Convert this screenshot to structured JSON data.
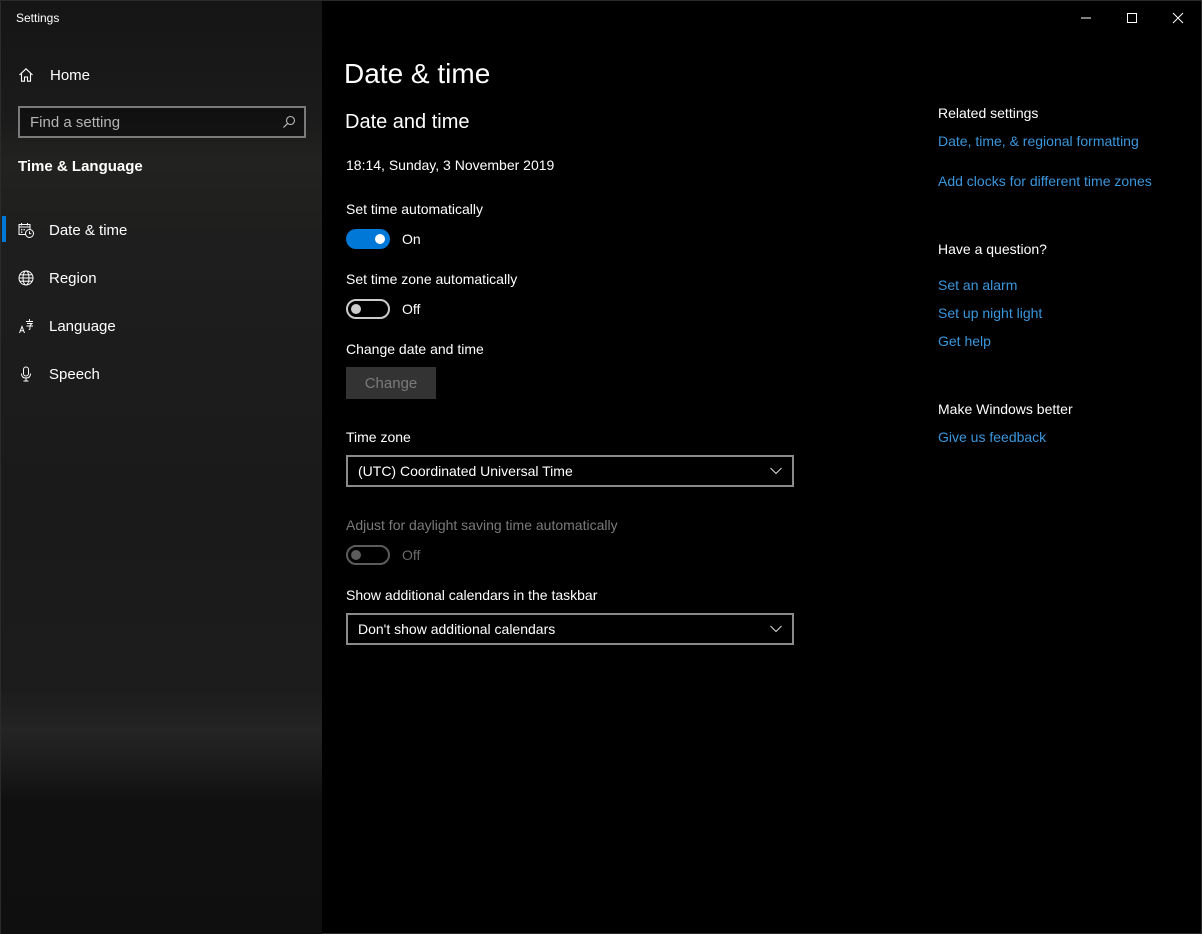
{
  "window": {
    "title": "Settings",
    "controls": {
      "minimize": "minimize-icon",
      "maximize": "maximize-icon",
      "close": "close-icon"
    }
  },
  "sidebar": {
    "home_label": "Home",
    "search_placeholder": "Find a setting",
    "section_title": "Time & Language",
    "items": [
      {
        "label": "Date & time",
        "icon": "calendar-clock-icon",
        "active": true
      },
      {
        "label": "Region",
        "icon": "globe-icon",
        "active": false
      },
      {
        "label": "Language",
        "icon": "language-icon",
        "active": false
      },
      {
        "label": "Speech",
        "icon": "microphone-icon",
        "active": false
      }
    ]
  },
  "main": {
    "page_title": "Date & time",
    "section_title": "Date and time",
    "current_datetime": "18:14, Sunday, 3 November 2019",
    "set_time_auto": {
      "label": "Set time automatically",
      "state": "On"
    },
    "set_timezone_auto": {
      "label": "Set time zone automatically",
      "state": "Off"
    },
    "change_datetime": {
      "label": "Change date and time",
      "button": "Change"
    },
    "time_zone": {
      "label": "Time zone",
      "value": "(UTC) Coordinated Universal Time"
    },
    "daylight_saving": {
      "label": "Adjust for daylight saving time automatically",
      "state": "Off"
    },
    "additional_calendars": {
      "label": "Show additional calendars in the taskbar",
      "value": "Don't show additional calendars"
    }
  },
  "right_panel": {
    "related_heading": "Related settings",
    "related_links": [
      "Date, time, & regional formatting",
      "Add clocks for different time zones"
    ],
    "question_heading": "Have a question?",
    "question_links": [
      "Set an alarm",
      "Set up night light",
      "Get help"
    ],
    "feedback_heading": "Make Windows better",
    "feedback_link": "Give us feedback"
  },
  "colors": {
    "accent": "#0078d7",
    "link": "#3a96dd",
    "background": "#000000",
    "sidebar": "#1b1b1b"
  }
}
